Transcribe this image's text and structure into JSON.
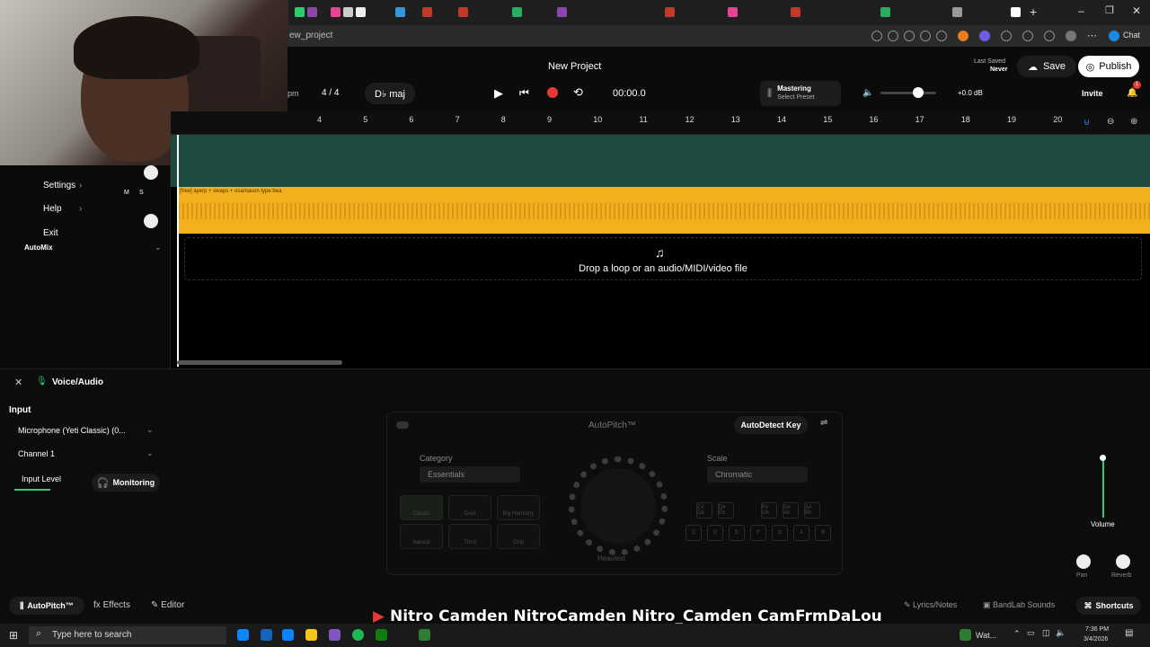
{
  "browser": {
    "url": "ew_project",
    "chat_label": "Chat"
  },
  "project": {
    "title": "New Project",
    "last_saved_label": "Last Saved",
    "last_saved_value": "Never",
    "save_label": "Save",
    "publish_label": "Publish",
    "invite_label": "Invite",
    "notification_count": "1"
  },
  "transport": {
    "bpm_suffix": "pm",
    "time_signature": "4 / 4",
    "key": "D♭ maj",
    "time": "00:00.0",
    "mastering_label": "Mastering",
    "mastering_preset": "Select Preset",
    "master_volume": "+0.0 dB"
  },
  "ruler": {
    "ticks": [
      "4",
      "5",
      "6",
      "7",
      "8",
      "9",
      "10",
      "11",
      "12",
      "13",
      "14",
      "15",
      "16",
      "17",
      "18",
      "19",
      "20"
    ]
  },
  "tracks": {
    "clip_name": "[free] ayerp + swaps + osamason type bea",
    "drop_hint": "Drop a loop or an audio/MIDI/video file"
  },
  "context_menu": {
    "items": [
      "Settings",
      "Help",
      "Exit"
    ]
  },
  "left_panel": {
    "automix_label": "AutoMix",
    "mute": "M",
    "solo": "S"
  },
  "voice_panel": {
    "title": "Voice/Audio",
    "input_label": "Input",
    "input_device": "Microphone (Yeti Classic) (0...",
    "channel": "Channel 1",
    "input_level_label": "Input Level",
    "monitoring_label": "Monitoring"
  },
  "autopitch": {
    "title": "AutoPitch™",
    "autodetect_label": "AutoDetect Key",
    "category_label": "Category",
    "category_value": "Essentials",
    "scale_label": "Scale",
    "scale_value": "Chromatic",
    "dial_label": "Heaviest",
    "presets": [
      "Classic",
      "Duet",
      "Big Harmony",
      "Natural",
      "Third",
      "Chip"
    ],
    "top_keys": [
      "C# Db",
      "D# Eb",
      "F# Gb",
      "G# Ab",
      "A# Bb"
    ],
    "bottom_keys": [
      "C",
      "D",
      "E",
      "F",
      "G",
      "A",
      "B"
    ]
  },
  "mixer": {
    "volume_label": "Volume",
    "pan_label": "Pan",
    "reverb_label": "Reverb"
  },
  "bottom_tabs": {
    "autopitch": "AutoPitch™",
    "effects": "Effects",
    "editor": "Editor",
    "lyrics": "Lyrics/Notes",
    "sounds": "BandLab Sounds",
    "shortcuts": "Shortcuts"
  },
  "overlay": {
    "text": "Nitro Camden  NitroCamden  Nitro_Camden  CamFrmDaLou"
  },
  "taskbar": {
    "search_placeholder": "Type here to search",
    "weather": "Wat...",
    "time": "7:36 PM",
    "date": "3/4/2026"
  },
  "colors": {
    "accent_green": "#1e4a40",
    "clip_yellow": "#f2b01e",
    "record_red": "#e53935"
  }
}
